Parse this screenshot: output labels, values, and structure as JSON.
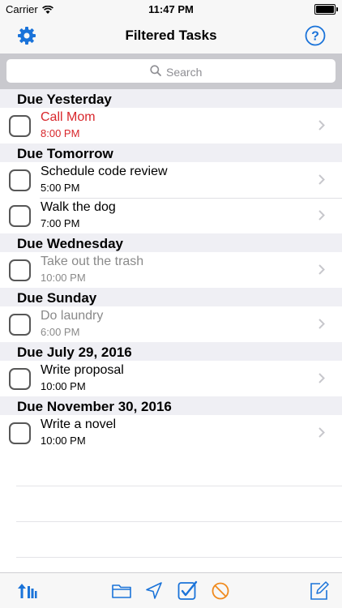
{
  "status": {
    "carrier": "Carrier",
    "time": "11:47 PM"
  },
  "nav": {
    "title": "Filtered Tasks",
    "left_icon": "gear-icon",
    "right_icon": "help-icon"
  },
  "search": {
    "placeholder": "Search"
  },
  "colors": {
    "accent": "#1a73d9",
    "overdue": "#d8262b",
    "cancel": "#f08a1d",
    "section_bg": "#efeff4"
  },
  "sections": [
    {
      "header": "Due Yesterday",
      "tasks": [
        {
          "title": "Call Mom",
          "time": "8:00 PM"
        }
      ]
    },
    {
      "header": "Due Tomorrow",
      "tasks": [
        {
          "title": "Schedule code review",
          "time": "5:00 PM"
        },
        {
          "title": "Walk the dog",
          "time": "7:00 PM"
        }
      ]
    },
    {
      "header": "Due Wednesday",
      "tasks": [
        {
          "title": "Take out the trash",
          "time": "10:00 PM"
        }
      ]
    },
    {
      "header": "Due Sunday",
      "tasks": [
        {
          "title": "Do laundry",
          "time": "6:00 PM"
        }
      ]
    },
    {
      "header": "Due July 29, 2016",
      "tasks": [
        {
          "title": "Write proposal",
          "time": "10:00 PM"
        }
      ]
    },
    {
      "header": "Due November 30, 2016",
      "tasks": [
        {
          "title": "Write a novel",
          "time": "10:00 PM"
        }
      ]
    }
  ],
  "toolbar": {
    "icons": [
      "sort-icon",
      "folder-icon",
      "location-arrow-icon",
      "checkmark-box-icon",
      "cancel-icon",
      "compose-icon"
    ]
  }
}
